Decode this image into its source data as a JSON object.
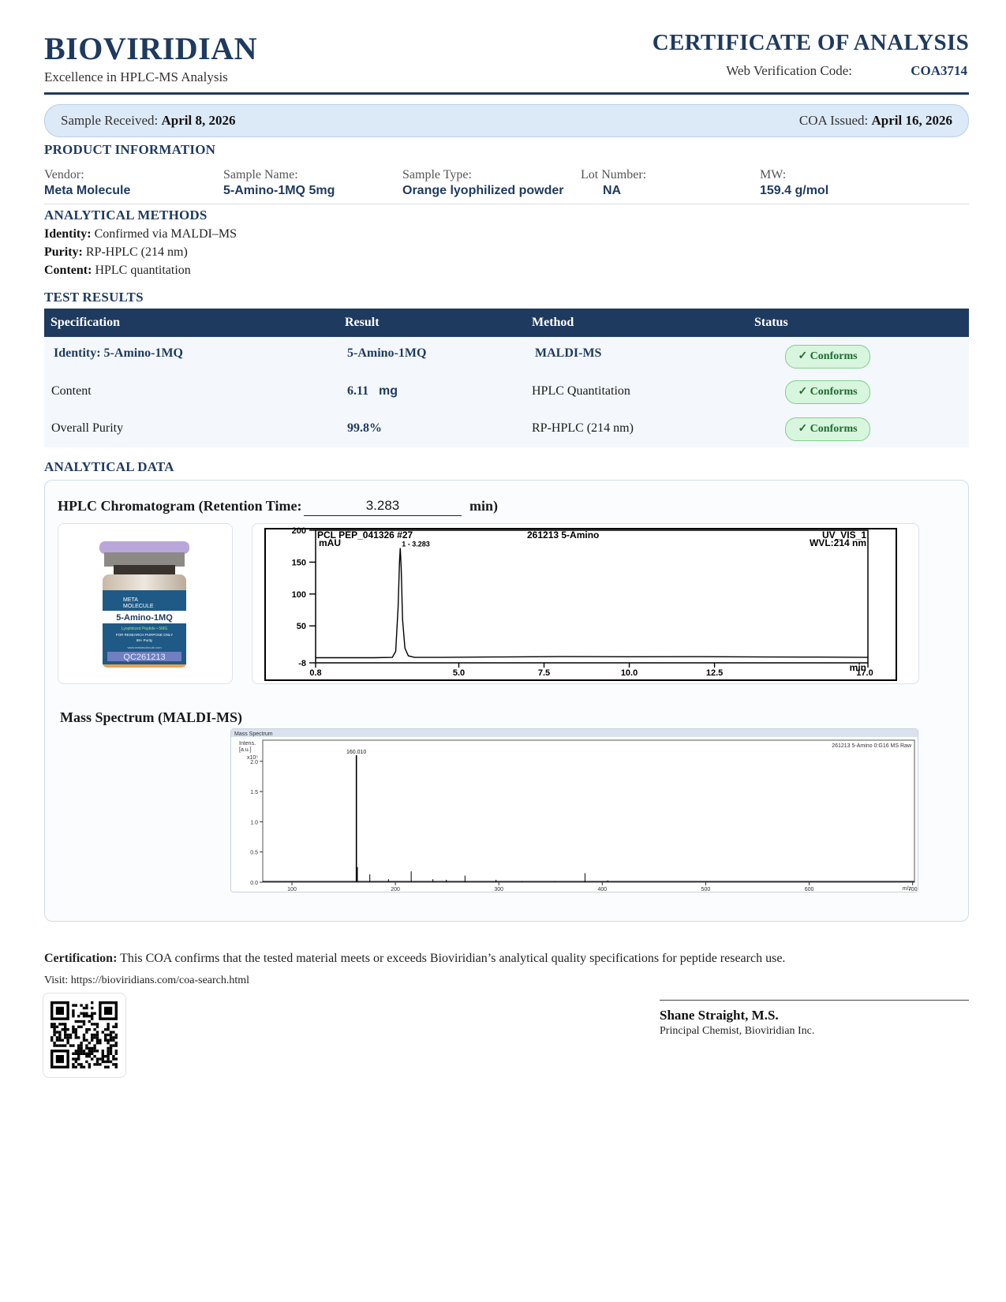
{
  "header": {
    "brand": "BIOVIRIDIAN",
    "tagline": "Excellence in HPLC-MS Analysis",
    "title": "CERTIFICATE OF ANALYSIS",
    "verification_label": "Web Verification Code:",
    "verification_code": "COA3714"
  },
  "dates": {
    "received_label": "Sample Received:",
    "received_value": "April 8, 2026",
    "issued_label": "COA Issued:",
    "issued_value": "April 16, 2026"
  },
  "product_info": {
    "title": "PRODUCT INFORMATION",
    "fields": [
      {
        "label": "Vendor:",
        "value": "Meta Molecule"
      },
      {
        "label": "Sample Name:",
        "value": "5-Amino-1MQ 5mg"
      },
      {
        "label": "Sample Type:",
        "value": "Orange lyophilized powder"
      },
      {
        "label": "Lot Number:",
        "value": "NA"
      },
      {
        "label": "MW:",
        "value": "159.4 g/mol"
      }
    ]
  },
  "methods": {
    "title": "ANALYTICAL METHODS",
    "items": [
      {
        "label": "Identity:",
        "value": "Confirmed via MALDI–MS"
      },
      {
        "label": "Purity:",
        "value": "RP-HPLC (214 nm)"
      },
      {
        "label": "Content:",
        "value": "HPLC quantitation"
      }
    ]
  },
  "results": {
    "title": "TEST RESULTS",
    "headers": [
      "Specification",
      "Result",
      "Method",
      "Status"
    ],
    "rows": [
      {
        "spec": "Identity:  5-Amino-1MQ",
        "result": "5-Amino-1MQ",
        "unit": "",
        "method": "MALDI-MS",
        "status": "✓ Conforms"
      },
      {
        "spec": "Content",
        "result": "6.11",
        "unit": "mg",
        "method": "HPLC Quantitation",
        "status": "✓ Conforms"
      },
      {
        "spec": "Overall Purity",
        "result": "99.8%",
        "unit": "",
        "method": "RP-HPLC (214 nm)",
        "status": "✓ Conforms"
      }
    ]
  },
  "analytical_data": {
    "title": "ANALYTICAL DATA",
    "hplc_title": "HPLC Chromatogram (Retention Time:",
    "retention_time": "3.283",
    "retention_unit": "min)",
    "ms_title": "Mass Spectrum (MALDI-MS)"
  },
  "vial": {
    "brand_line1": "META",
    "brand_line2": "MOLECULE",
    "product": "5-Amino-1MQ",
    "sub": "Lyophilized Peptide • 5MG",
    "note": "FOR RESEARCH PURPOSE ONLY",
    "purity": "99+ Purity",
    "url": "www.metamolecule.com",
    "qc": "QC261213",
    "cap_color": "#b9a7d9",
    "label_color": "#1f5a86",
    "liquid_color": "#e3a35a"
  },
  "chart_data": [
    {
      "type": "line",
      "header_left": "PCL PEP_041326 #27",
      "header_mid": "261213 5-Amino",
      "header_right_1": "UV_VIS_1",
      "header_right_2": "WVL:214 nm",
      "ylabel": "mAU",
      "xlabel": "min",
      "xlim": [
        0.8,
        17.0
      ],
      "ylim": [
        -8,
        200
      ],
      "x_ticks": [
        "0.8",
        "5.0",
        "7.5",
        "10.0",
        "12.5",
        "17.0"
      ],
      "x_tick_values": [
        0.8,
        5.0,
        7.5,
        10.0,
        12.5,
        17.0
      ],
      "y_ticks": [
        "200",
        "150",
        "100",
        "50",
        "-8"
      ],
      "y_tick_values": [
        200,
        150,
        100,
        50,
        -8
      ],
      "peak_label": "1 - 3.283",
      "series": [
        {
          "x": [
            0.8,
            2.5,
            3.05,
            3.15,
            3.22,
            3.26,
            3.283,
            3.31,
            3.35,
            3.42,
            3.52,
            3.7,
            4.5,
            6.0,
            8.0,
            10.0,
            12.0,
            14.0,
            15.5,
            16.5,
            17.0
          ],
          "y": [
            0,
            0,
            0.5,
            10,
            80,
            150,
            172,
            140,
            60,
            15,
            3,
            0.5,
            0.5,
            1.2,
            1.8,
            1.5,
            1.6,
            1.2,
            1.0,
            0.8,
            0.6
          ]
        }
      ]
    },
    {
      "type": "line",
      "window_title": "Mass Spectrum",
      "header_right": "261213 5-Amino 0:G16 MS Raw",
      "ylabel": "Intens.\n[a.u.]",
      "y_exponent": "x10⁵",
      "xlabel": "m/z",
      "xlim": [
        100,
        730
      ],
      "ylim": [
        0,
        2.35
      ],
      "x_ticks": [
        "100",
        "200",
        "300",
        "400",
        "500",
        "600",
        "700"
      ],
      "x_tick_values": [
        100,
        200,
        300,
        400,
        500,
        600,
        700
      ],
      "y_ticks": [
        "2.0",
        "1.5",
        "1.0",
        "0.5",
        "0.0"
      ],
      "y_tick_values": [
        2.0,
        1.5,
        1.0,
        0.5,
        0.0
      ],
      "peak_label": "160.010",
      "series": [
        {
          "x": [
            160.01,
            161.0,
            173.0,
            191.0,
            213.0,
            234.0,
            247.0,
            265.0,
            295.0,
            320.0,
            352.0,
            381.0,
            403.0
          ],
          "y": [
            2.1,
            0.25,
            0.13,
            0.05,
            0.18,
            0.05,
            0.04,
            0.11,
            0.04,
            0.02,
            0.02,
            0.15,
            0.03
          ]
        }
      ]
    }
  ],
  "certification": {
    "label": "Certification:",
    "text": "This COA confirms that the tested material meets or exceeds Bioviridian’s analytical quality specifications for peptide research use.",
    "visit": "Visit: https://bioviridians.com/coa-search.html"
  },
  "signature": {
    "name": "Shane Straight, M.S.",
    "role": "Principal Chemist, Bioviridian Inc."
  }
}
